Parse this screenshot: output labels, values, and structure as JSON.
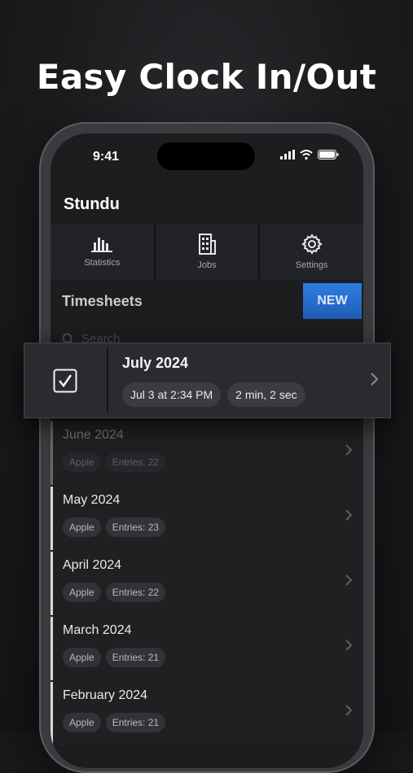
{
  "headline": "Easy Clock In/Out",
  "status_bar": {
    "time": "9:41"
  },
  "app": {
    "title": "Stundu",
    "nav": [
      {
        "label": "Statistics",
        "icon": "bar-chart-icon"
      },
      {
        "label": "Jobs",
        "icon": "building-icon"
      },
      {
        "label": "Settings",
        "icon": "gear-icon"
      }
    ],
    "section_title": "Timesheets",
    "new_button": "NEW",
    "search_placeholder": "Search"
  },
  "active_timesheet": {
    "title": "July 2024",
    "started": "Jul 3 at 2:34 PM",
    "duration": "2 min, 2 sec",
    "checked": true
  },
  "timesheets": [
    {
      "name": "June 2024",
      "job": "Apple",
      "entries": "Entries: 22"
    },
    {
      "name": "May 2024",
      "job": "Apple",
      "entries": "Entries: 23"
    },
    {
      "name": "April 2024",
      "job": "Apple",
      "entries": "Entries: 22"
    },
    {
      "name": "March 2024",
      "job": "Apple",
      "entries": "Entries: 21"
    },
    {
      "name": "February 2024",
      "job": "Apple",
      "entries": "Entries: 21"
    }
  ],
  "colors": {
    "accent": "#2f7de0",
    "background": "#1c1d1f"
  }
}
